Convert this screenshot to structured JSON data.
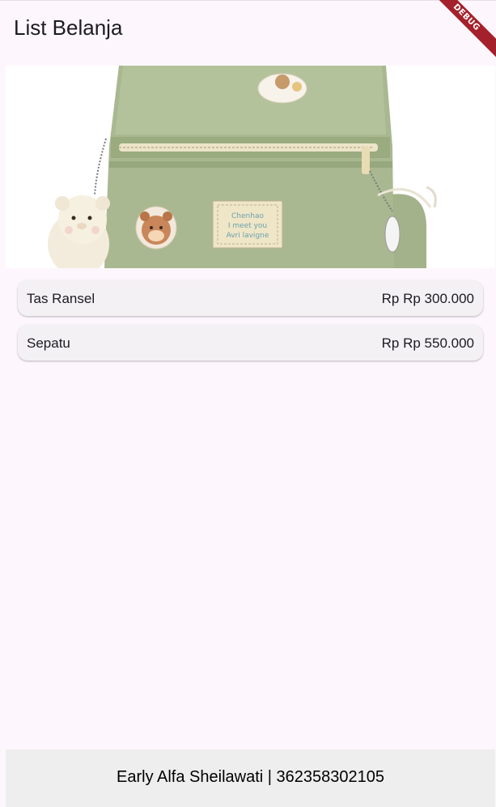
{
  "appbar": {
    "title": "List Belanja",
    "debug_label": "DEBUG"
  },
  "hero": {
    "label_lines": [
      "Chenhao",
      "I meet you",
      "Avri lavigne"
    ]
  },
  "items": [
    {
      "name": "Tas Ransel",
      "price": "Rp Rp 300.000"
    },
    {
      "name": "Sepatu",
      "price": "Rp Rp 550.000"
    }
  ],
  "footer": {
    "text": "Early Alfa Sheilawati | 362358302105"
  },
  "colors": {
    "background": "#fdf7fd",
    "debug_banner": "#a4212b",
    "bag": "#a9b890"
  }
}
